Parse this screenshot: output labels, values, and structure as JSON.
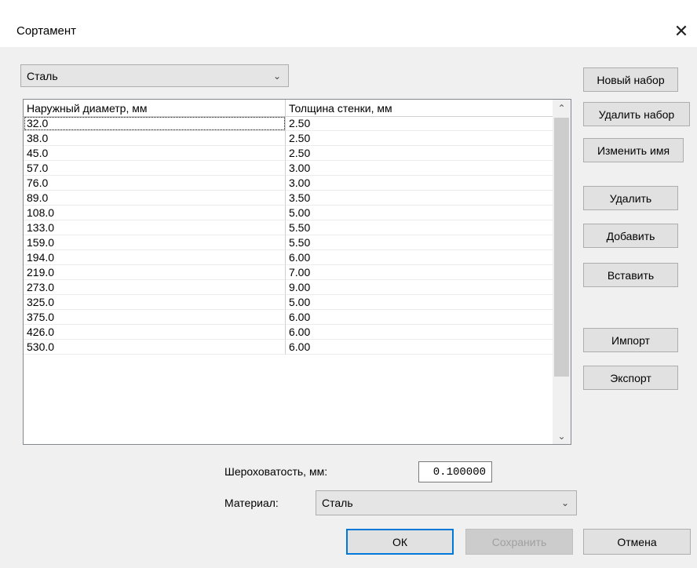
{
  "window": {
    "title": "Сортамент",
    "close_glyph": "✕"
  },
  "set_selector": {
    "value": "Сталь"
  },
  "table": {
    "headers": [
      "Наружный диаметр, мм",
      "Толщина стенки, мм"
    ],
    "rows": [
      [
        "32.0",
        "2.50"
      ],
      [
        "38.0",
        "2.50"
      ],
      [
        "45.0",
        "2.50"
      ],
      [
        "57.0",
        "3.00"
      ],
      [
        "76.0",
        "3.00"
      ],
      [
        "89.0",
        "3.50"
      ],
      [
        "108.0",
        "5.00"
      ],
      [
        "133.0",
        "5.50"
      ],
      [
        "159.0",
        "5.50"
      ],
      [
        "194.0",
        "6.00"
      ],
      [
        "219.0",
        "7.00"
      ],
      [
        "273.0",
        "9.00"
      ],
      [
        "325.0",
        "5.00"
      ],
      [
        "375.0",
        "6.00"
      ],
      [
        "426.0",
        "6.00"
      ],
      [
        "530.0",
        "6.00"
      ]
    ]
  },
  "side_buttons": {
    "new_set": "Новый набор",
    "delete_set": "Удалить набор",
    "rename": "Изменить имя",
    "delete": "Удалить",
    "add": "Добавить",
    "insert": "Вставить",
    "import": "Импорт",
    "export": "Экспорт"
  },
  "roughness": {
    "label": "Шероховатость, мм:",
    "value": "0.100000"
  },
  "material": {
    "label": "Материал:",
    "value": "Сталь"
  },
  "footer": {
    "ok": "ОК",
    "save": "Сохранить",
    "cancel": "Отмена"
  },
  "colors": {
    "accent": "#0078d7",
    "client_bg": "#f0f0f0",
    "button_bg": "#e1e1e1"
  }
}
